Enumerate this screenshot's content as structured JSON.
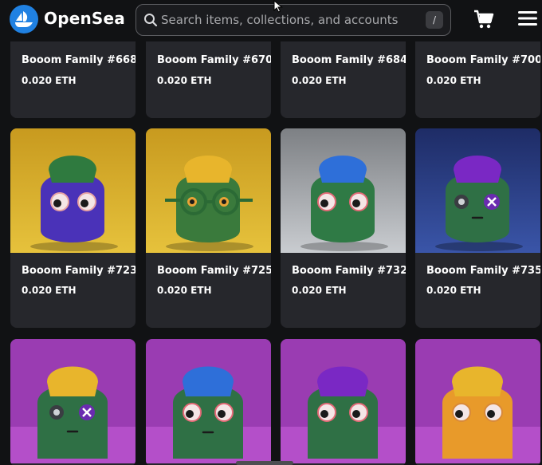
{
  "header": {
    "brand": "OpenSea",
    "search_placeholder": "Search items, collections, and accounts",
    "search_shortcut": "/",
    "brand_color": "#2081E2"
  },
  "icons": [
    "opensea-logo-icon",
    "search-icon",
    "cart-icon",
    "menu-icon",
    "cursor-icon"
  ],
  "rows": [
    {
      "cards": [
        {
          "title": "Booom Family #668",
          "price": "0.020 ETH"
        },
        {
          "title": "Booom Family #670",
          "price": "0.020 ETH"
        },
        {
          "title": "Booom Family #684",
          "price": "0.020 ETH"
        },
        {
          "title": "Booom Family #700",
          "price": "0.020 ETH"
        }
      ]
    },
    {
      "cards": [
        {
          "title": "Booom Family #723",
          "price": "0.020 ETH",
          "bg": "#d7ac2a",
          "hat": "#2f7a3f",
          "body": "#4a32b8",
          "eyes": "open",
          "glasses": false
        },
        {
          "title": "Booom Family #725",
          "price": "0.020 ETH",
          "bg": "#d7ac2a",
          "hat": "#e8b52c",
          "body": "#3a7a3c",
          "eyes": "glasses",
          "glasses": true
        },
        {
          "title": "Booom Family #732",
          "price": "0.020 ETH",
          "bg": "#9a9da1",
          "hat": "#2e6fd9",
          "body": "#2f7a45",
          "eyes": "open",
          "glasses": false
        },
        {
          "title": "Booom Family #735",
          "price": "0.020 ETH",
          "bg": "#2c3e86",
          "hat": "#7a28c4",
          "body": "#2f7045",
          "eyes": "x",
          "glasses": false
        }
      ]
    },
    {
      "cards": [
        {
          "bg": "#a03fb8",
          "hat": "#e8b52c",
          "body": "#2f7045",
          "eyes": "x"
        },
        {
          "bg": "#a03fb8",
          "hat": "#2e6fd9",
          "body": "#2f7045",
          "eyes": "open"
        },
        {
          "bg": "#a03fb8",
          "hat": "#7a28c4",
          "body": "#2f7045",
          "eyes": "open"
        },
        {
          "bg": "#a03fb8",
          "hat": "#e8b52c",
          "body": "#e89a2a",
          "eyes": "open"
        }
      ]
    }
  ]
}
